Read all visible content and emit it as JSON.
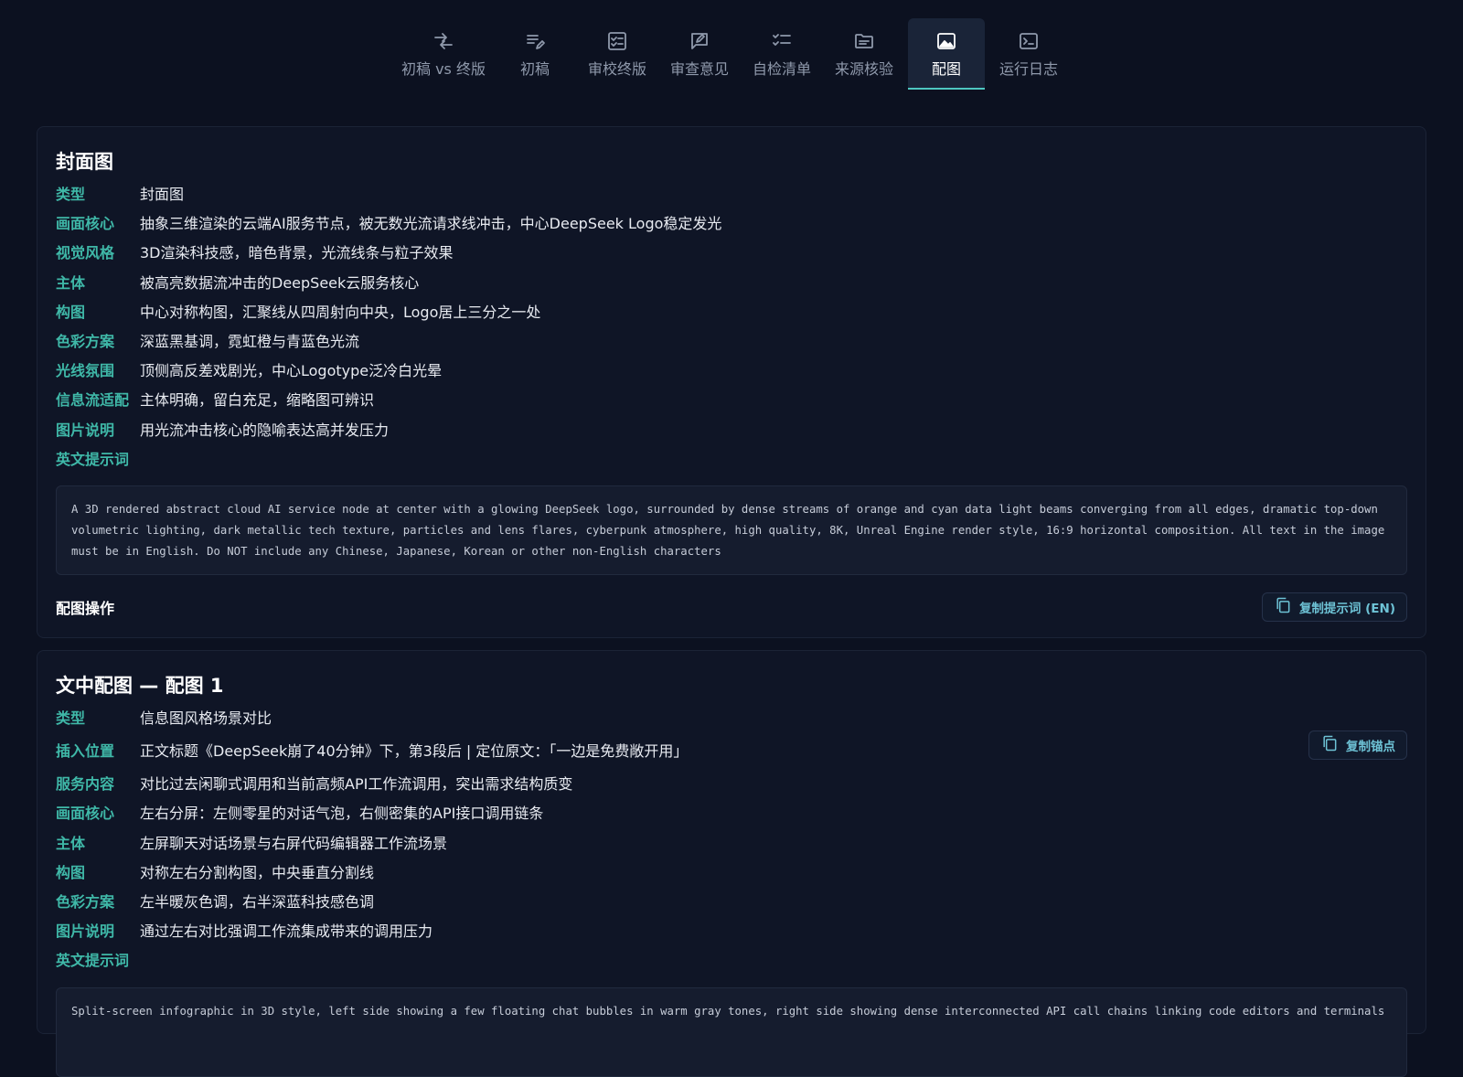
{
  "tabs": [
    {
      "label": "初稿 vs 终版",
      "icon": "compare-arrows-icon"
    },
    {
      "label": "初稿",
      "icon": "edit-lines-icon"
    },
    {
      "label": "审校终版",
      "icon": "checklist-box-icon"
    },
    {
      "label": "审查意见",
      "icon": "comment-edit-icon"
    },
    {
      "label": "自检清单",
      "icon": "checklist-icon"
    },
    {
      "label": "来源核验",
      "icon": "folder-icon"
    },
    {
      "label": "配图",
      "icon": "image-icon",
      "active": true
    },
    {
      "label": "运行日志",
      "icon": "terminal-icon"
    }
  ],
  "cover": {
    "title": "封面图",
    "fields": [
      {
        "k": "类型",
        "v": "封面图"
      },
      {
        "k": "画面核心",
        "v": "抽象三维渲染的云端AI服务节点，被无数光流请求线冲击，中心DeepSeek Logo稳定发光"
      },
      {
        "k": "视觉风格",
        "v": "3D渲染科技感，暗色背景，光流线条与粒子效果"
      },
      {
        "k": "主体",
        "v": "被高亮数据流冲击的DeepSeek云服务核心"
      },
      {
        "k": "构图",
        "v": "中心对称构图，汇聚线从四周射向中央，Logo居上三分之一处"
      },
      {
        "k": "色彩方案",
        "v": "深蓝黑基调，霓虹橙与青蓝色光流"
      },
      {
        "k": "光线氛围",
        "v": "顶侧高反差戏剧光，中心Logotype泛冷白光晕"
      },
      {
        "k": "信息流适配",
        "v": "主体明确，留白充足，缩略图可辨识"
      },
      {
        "k": "图片说明",
        "v": "用光流冲击核心的隐喻表达高并发压力"
      },
      {
        "k": "英文提示词",
        "v": ""
      }
    ],
    "prompt": "A 3D rendered abstract cloud AI service node at center with a glowing DeepSeek logo, surrounded by dense streams of orange and cyan data light beams converging from all edges, dramatic top-down volumetric lighting, dark metallic tech texture, particles and lens flares, cyberpunk atmosphere, high quality, 8K, Unreal Engine render style, 16:9 horizontal composition. All text in the image must be in English. Do NOT include any Chinese, Japanese, Korean or other non-English characters",
    "ops_label": "配图操作",
    "copy_prompt_label": "复制提示词 (EN)"
  },
  "inline1": {
    "title": "文中配图 — 配图 1",
    "fields": [
      {
        "k": "类型",
        "v": "信息图风格场景对比"
      },
      {
        "k": "插入位置",
        "v": "正文标题《DeepSeek崩了40分钟》下，第3段后 | 定位原文：「一边是免费敞开用」"
      },
      {
        "k": "服务内容",
        "v": "对比过去闲聊式调用和当前高频API工作流调用，突出需求结构质变"
      },
      {
        "k": "画面核心",
        "v": "左右分屏：左侧零星的对话气泡，右侧密集的API接口调用链条"
      },
      {
        "k": "主体",
        "v": "左屏聊天对话场景与右屏代码编辑器工作流场景"
      },
      {
        "k": "构图",
        "v": "对称左右分割构图，中央垂直分割线"
      },
      {
        "k": "色彩方案",
        "v": "左半暖灰色调，右半深蓝科技感色调"
      },
      {
        "k": "图片说明",
        "v": "通过左右对比强调工作流集成带来的调用压力"
      },
      {
        "k": "英文提示词",
        "v": ""
      }
    ],
    "copy_anchor_label": "复制锚点",
    "prompt": "Split-screen infographic in 3D style, left side showing a few floating chat bubbles in warm gray tones, right side showing dense interconnected API call chains linking code editors and terminals"
  }
}
